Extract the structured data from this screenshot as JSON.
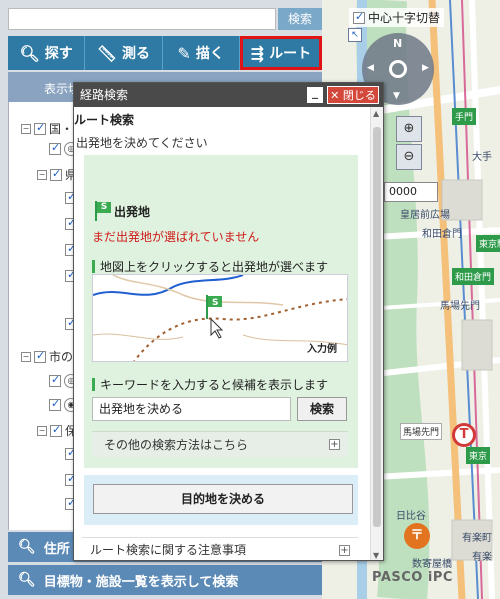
{
  "map": {
    "layer_checkbox_label": "中心十字切替",
    "compass_north": "N",
    "scale_value": "0000",
    "credit": "PASCO iPC",
    "labels": [
      "手門",
      "大手",
      "和田倉門",
      "馬場先門",
      "東京",
      "有楽町",
      "日比谷",
      "東京駅",
      "皇居前広場",
      "和田倉門",
      "馬場先門",
      "有楽",
      "数寄屋橋"
    ],
    "icons": [
      "zoom-in-icon",
      "zoom-out-icon",
      "compass-icon",
      "metro-icon",
      "post-office-icon"
    ]
  },
  "left": {
    "search_button": "検索",
    "search_placeholder": "",
    "toolbar": {
      "search": "探す",
      "measure": "測る",
      "draw": "描く",
      "route": "ルート"
    },
    "display_tab": "表示切",
    "tree": {
      "items": [
        {
          "label": "国・",
          "checked": true
        },
        {
          "label": "",
          "checked": true
        },
        {
          "label": "県",
          "checked": true
        },
        {
          "label": "",
          "checked": true
        },
        {
          "label": "",
          "checked": true
        },
        {
          "label": "",
          "checked": true
        },
        {
          "label": "",
          "checked": true
        },
        {
          "label": "",
          "checked": true
        },
        {
          "label": "市の",
          "checked": true
        },
        {
          "label": "",
          "checked": true
        },
        {
          "label": "",
          "checked": true
        },
        {
          "label": "保",
          "checked": true
        },
        {
          "label": "",
          "checked": true
        },
        {
          "label": "",
          "checked": true
        },
        {
          "label": "",
          "checked": true
        },
        {
          "label": "",
          "checked": true
        },
        {
          "label": "",
          "checked": true
        }
      ]
    },
    "accordion": {
      "address": "住所",
      "landmark": "目標物・施設一覧を表示して検索"
    }
  },
  "dialog": {
    "title": "経路検索",
    "minimize": "_",
    "close": "閉じる",
    "section_heading": "ルート検索",
    "instruction": "出発地を決めてください",
    "origin": {
      "heading": "出発地",
      "flag_letter": "S",
      "warning": "まだ出発地が選ばれていません",
      "map_hint": "地図上をクリックすると出発地が選べます",
      "example_label": "入力例",
      "keyword_hint": "キーワードを入力すると候補を表示します",
      "input_value": "出発地を決める",
      "search_button": "検索",
      "other_methods": "その他の検索方法はこちら"
    },
    "destination_button": "目的地を決める",
    "notes": "ルート検索に関する注意事項",
    "colors": {
      "green_panel": "#dff2df",
      "blue_panel": "#dbeef8",
      "warning": "#d01a1a",
      "accent_green": "#3bab52",
      "toolbar": "#2e7aa4",
      "close_red": "#d4483c",
      "active_outline": "#e01414"
    }
  }
}
